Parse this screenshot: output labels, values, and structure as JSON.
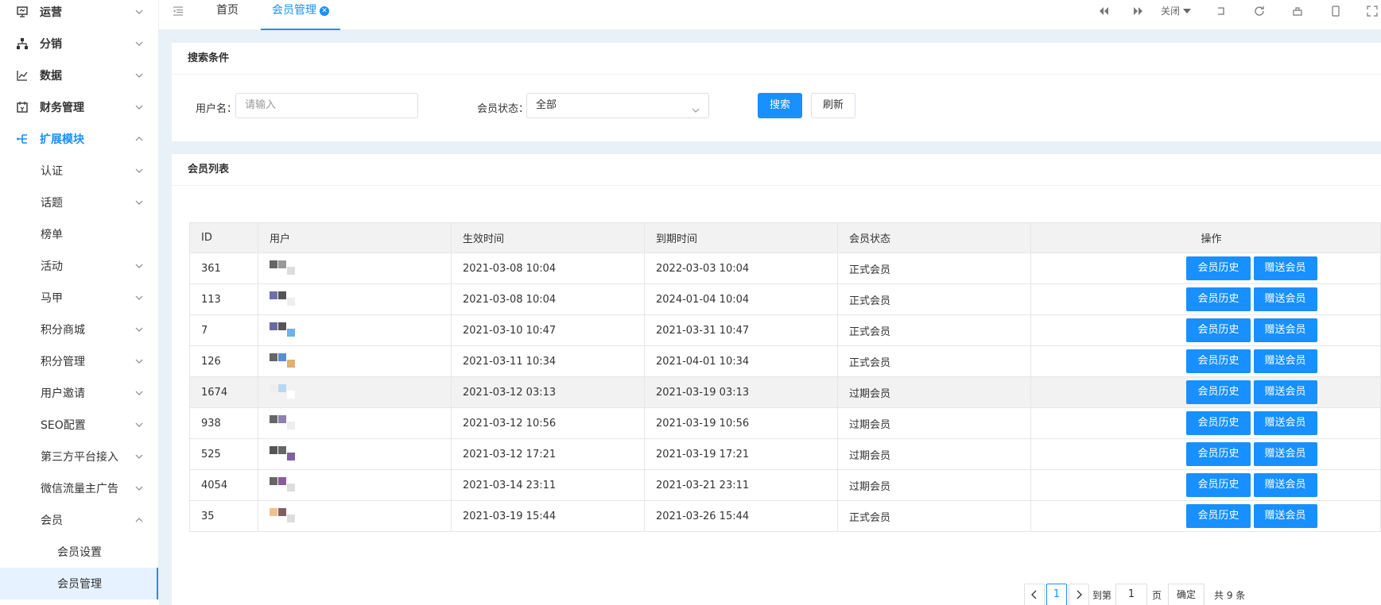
{
  "sidebar": {
    "items": [
      {
        "label": "运营",
        "type": "top",
        "icon": "monitor-icon",
        "expanded": false
      },
      {
        "label": "分销",
        "type": "top",
        "icon": "sitemap-icon",
        "expanded": false
      },
      {
        "label": "数据",
        "type": "top",
        "icon": "line-chart-icon",
        "expanded": false
      },
      {
        "label": "财务管理",
        "type": "top",
        "icon": "calendar-icon",
        "expanded": false
      },
      {
        "label": "扩展模块",
        "type": "top",
        "icon": "extension-icon",
        "expanded": true
      },
      {
        "label": "认证",
        "type": "sub",
        "hasChildren": true
      },
      {
        "label": "话题",
        "type": "sub",
        "hasChildren": true
      },
      {
        "label": "榜单",
        "type": "sub",
        "hasChildren": false
      },
      {
        "label": "活动",
        "type": "sub",
        "hasChildren": true
      },
      {
        "label": "马甲",
        "type": "sub",
        "hasChildren": true
      },
      {
        "label": "积分商城",
        "type": "sub",
        "hasChildren": true
      },
      {
        "label": "积分管理",
        "type": "sub",
        "hasChildren": true
      },
      {
        "label": "用户邀请",
        "type": "sub",
        "hasChildren": true
      },
      {
        "label": "SEO配置",
        "type": "sub",
        "hasChildren": true
      },
      {
        "label": "第三方平台接入",
        "type": "sub",
        "hasChildren": true
      },
      {
        "label": "微信流量主广告",
        "type": "sub",
        "hasChildren": true
      },
      {
        "label": "会员",
        "type": "sub",
        "hasChildren": true,
        "expanded": true
      },
      {
        "label": "会员设置",
        "type": "sub2"
      },
      {
        "label": "会员管理",
        "type": "sub2",
        "selected": true
      }
    ]
  },
  "topbar": {
    "tabs": [
      {
        "label": "首页"
      },
      {
        "label": "会员管理",
        "active": true
      }
    ],
    "close_label": "关闭"
  },
  "search": {
    "title": "搜索条件",
    "username_label": "用户名：",
    "username_placeholder": "请输入",
    "status_label": "会员状态：",
    "status_value": "全部",
    "search_button": "搜索",
    "refresh_button": "刷新"
  },
  "list": {
    "title": "会员列表",
    "columns": [
      "ID",
      "用户",
      "生效时间",
      "到期时间",
      "会员状态",
      "操作"
    ],
    "rows": [
      {
        "id": "361",
        "start": "2021-03-08 10:04",
        "end": "2022-03-03 10:04",
        "status": "正式会员"
      },
      {
        "id": "113",
        "start": "2021-03-08 10:04",
        "end": "2024-01-04 10:04",
        "status": "正式会员"
      },
      {
        "id": "7",
        "start": "2021-03-10 10:47",
        "end": "2021-03-31 10:47",
        "status": "正式会员"
      },
      {
        "id": "126",
        "start": "2021-03-11 10:34",
        "end": "2021-04-01 10:34",
        "status": "正式会员"
      },
      {
        "id": "1674",
        "start": "2021-03-12 03:13",
        "end": "2021-03-19 03:13",
        "status": "过期会员"
      },
      {
        "id": "938",
        "start": "2021-03-12 10:56",
        "end": "2021-03-19 10:56",
        "status": "过期会员"
      },
      {
        "id": "525",
        "start": "2021-03-12 17:21",
        "end": "2021-03-19 17:21",
        "status": "过期会员"
      },
      {
        "id": "4054",
        "start": "2021-03-14 23:11",
        "end": "2021-03-21 23:11",
        "status": "过期会员"
      },
      {
        "id": "35",
        "start": "2021-03-19 15:44",
        "end": "2021-03-26 15:44",
        "status": "正式会员"
      }
    ],
    "history_button": "会员历史",
    "gift_button": "赠送会员"
  },
  "pagination": {
    "current_page": "1",
    "goto_label": "到第",
    "goto_value": "1",
    "page_unit": "页",
    "confirm_button": "确定",
    "total_text": "共 9 条"
  },
  "colors": {
    "primary": "#1890ff",
    "background": "#e8f1f8"
  }
}
